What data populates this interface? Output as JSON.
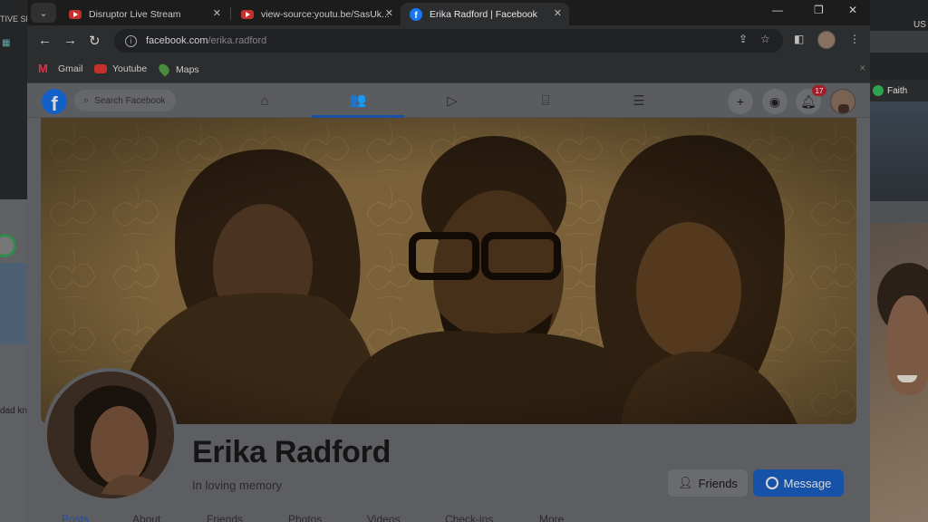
{
  "background": {
    "left_window_title": "TIVE SE",
    "left_window_text": "dad kn",
    "right_window_title": "US",
    "right_whatsapp_label": "Faith"
  },
  "browser": {
    "tabs": [
      {
        "title": "Disruptor Live Stream",
        "icon": "youtube-icon",
        "active": false
      },
      {
        "title": "view-source:youtu.be/SasUk...",
        "icon": "youtube-icon",
        "active": false
      },
      {
        "title": "Erika Radford | Facebook",
        "icon": "facebook-icon",
        "active": true
      }
    ],
    "url_host": "facebook.com",
    "url_path": "/erika.radford",
    "bookmarks": [
      {
        "label": "Gmail",
        "icon": "gmail-icon"
      },
      {
        "label": "Youtube",
        "icon": "youtube-icon"
      },
      {
        "label": "Maps",
        "icon": "maps-icon"
      }
    ]
  },
  "facebook": {
    "search_placeholder": "Search Facebook",
    "notification_count": "17",
    "profile": {
      "name": "Erika Radford",
      "subtitle": "In loving memory",
      "friends_label": "Friends",
      "message_label": "Message"
    },
    "profile_tabs": [
      {
        "label": "Posts",
        "active": true
      },
      {
        "label": "About",
        "active": false
      },
      {
        "label": "Friends",
        "active": false
      },
      {
        "label": "Photos",
        "active": false
      },
      {
        "label": "Videos",
        "active": false
      },
      {
        "label": "Check-ins",
        "active": false
      },
      {
        "label": "More",
        "active": false
      }
    ]
  },
  "colors": {
    "facebook_blue": "#1877f2",
    "overlay_dim": "#5d5e61",
    "cover_sepia": "#b8934f"
  }
}
